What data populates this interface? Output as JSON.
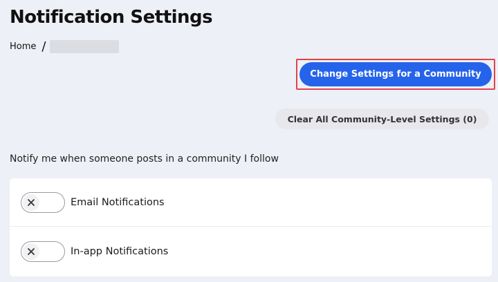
{
  "header": {
    "title": "Notification Settings"
  },
  "breadcrumb": {
    "home_label": "Home",
    "separator": "/"
  },
  "actions": {
    "change_settings_label": "Change Settings for a Community",
    "clear_all_label": "Clear All Community-Level Settings (0)"
  },
  "section": {
    "label": "Notify me when someone posts in a community I follow",
    "toggles": [
      {
        "label": "Email Notifications",
        "state": "off",
        "icon": "x-icon"
      },
      {
        "label": "In-app Notifications",
        "state": "off",
        "icon": "x-icon"
      }
    ]
  },
  "colors": {
    "accent": "#2563eb",
    "highlight": "#e0434a",
    "background": "#eef0f7"
  }
}
